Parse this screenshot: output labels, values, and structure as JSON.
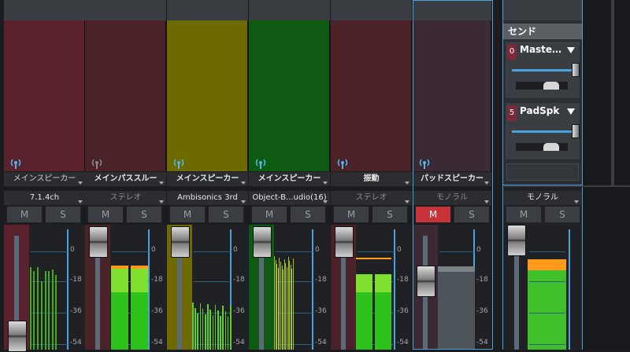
{
  "channels": [
    {
      "output": "メインスピーカー",
      "output_bright": false,
      "format": "7.1.4ch",
      "format_bright": true,
      "mute": "M",
      "solo": "S",
      "mute_on": false,
      "color": "#5a222c",
      "top": "#3b2028",
      "icon": "antenna-icon",
      "icon_color": "#4fb8e6"
    },
    {
      "output": "メインパススルー",
      "output_bright": true,
      "format": "ステレオ",
      "format_bright": false,
      "mute": "M",
      "solo": "S",
      "mute_on": false,
      "color": "#4a2228",
      "top": "#3b2028",
      "icon": "antenna-icon",
      "icon_color": "#888888"
    },
    {
      "output": "メインスピーカー",
      "output_bright": true,
      "format": "Ambisonics 3rd",
      "format_bright": true,
      "mute": "M",
      "solo": "S",
      "mute_on": false,
      "color": "#6f6a00",
      "top": "#6f6a00",
      "icon": "antenna-icon",
      "icon_color": "#4fb8e6"
    },
    {
      "output": "メインスピーカー",
      "output_bright": true,
      "format": "Object-B...udio(16)",
      "format_bright": true,
      "mute": "M",
      "solo": "S",
      "mute_on": false,
      "color": "#0f5a12",
      "top": "#0f5a12",
      "icon": "antenna-icon",
      "icon_color": "#4fb8e6"
    },
    {
      "output": "振動",
      "output_bright": true,
      "format": "ステレオ",
      "format_bright": false,
      "mute": "M",
      "solo": "S",
      "mute_on": false,
      "color": "#4a2228",
      "top": "#3b2028",
      "icon": "antenna-icon",
      "icon_color": "#4fb8e6"
    },
    {
      "output": "パッドスピーカー",
      "output_bright": true,
      "format": "モノラル",
      "format_bright": false,
      "mute": "M",
      "solo": "S",
      "mute_on": true,
      "color": "#3b2a33",
      "top": "#3b2a33",
      "icon": "antenna-icon",
      "icon_color": "#4fb8e6"
    }
  ],
  "send": {
    "header": "センド",
    "items": [
      {
        "num": "0",
        "name": "Maste…"
      },
      {
        "num": "5",
        "name": "PadSpk"
      }
    ]
  },
  "master": {
    "format": "モノラル",
    "mute": "M",
    "solo": "S"
  },
  "db_labels": [
    "0",
    "-18",
    "-36",
    "-54"
  ],
  "meter_levels": {
    "channel_2": [
      0.84,
      0.84
    ],
    "channel_3_peak": 0.48,
    "channel_5": [
      0.76,
      0.76
    ],
    "channel_6": 0.83,
    "master": 0.92
  },
  "colors": {
    "accent": "#4aa3df",
    "meter_green": "#2ec21c",
    "meter_bright": "#7fe030",
    "peak": "#ff9a1a",
    "mute_on": "#c8333a"
  }
}
